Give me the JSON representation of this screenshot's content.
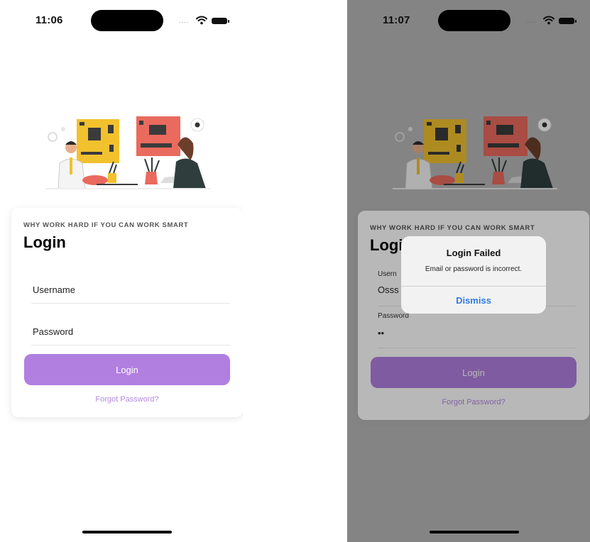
{
  "left_screen": {
    "status": {
      "time": "11:06"
    },
    "card": {
      "tagline": "WHY WORK HARD IF YOU CAN WORK SMART",
      "title": "Login",
      "username_placeholder": "Username",
      "password_placeholder": "Password",
      "login_button": "Login",
      "forgot_password": "Forgot Password?"
    }
  },
  "right_screen": {
    "status": {
      "time": "11:07"
    },
    "card": {
      "tagline": "WHY WORK HARD IF YOU CAN WORK SMART",
      "title": "Logi",
      "username_label": "Usern",
      "username_value": "Osss",
      "password_label": "Password",
      "password_value": "••",
      "login_button": "Login",
      "forgot_password": "Forgot Password?"
    },
    "alert": {
      "title": "Login Failed",
      "message": "Email or password is incorrect.",
      "dismiss": "Dismiss"
    }
  },
  "icons": [
    "wifi-icon",
    "battery-icon",
    "signal-dots-icon",
    "gear-icon"
  ],
  "colors": {
    "accent": "#b07fe0",
    "link": "#b48adf",
    "alert_button": "#2f7ce8",
    "circuit_yellow": "#f2c12e",
    "circuit_red": "#ea6a5e"
  }
}
